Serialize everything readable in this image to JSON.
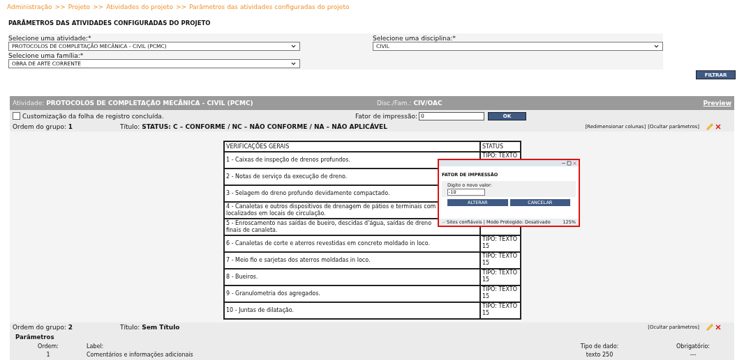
{
  "breadcrumb": {
    "separator": ">>",
    "items": [
      "Administração",
      "Projeto",
      "Atividades do projeto",
      "Parâmetros das atividades configuradas do projeto"
    ]
  },
  "page_title": "PARÂMETROS DAS ATIVIDADES CONFIGURADAS DO PROJETO",
  "filters": [
    {
      "label": "Selecione uma atividade:*",
      "value": "PROTOCOLOS DE COMPLETAÇÃO MECÂNICA - CIVIL (PCMC)"
    },
    {
      "label": "Selecione uma disciplina:*",
      "value": "CIVIL"
    },
    {
      "label": "Selecione uma família:*",
      "value": "OBRA DE ARTE CORRENTE"
    }
  ],
  "filter_button": "FILTRAR",
  "activity": {
    "label": "Atividade:",
    "value": "PROTOCOLOS DE COMPLETAÇÃO MECÂNICA - CIVIL (PCMC)",
    "disc_label": "Disc./Fam.:",
    "disc_value": "CIV/OAC",
    "preview": "Preview"
  },
  "customization": {
    "label": "Customização da folha de registro concluída.",
    "checked": false
  },
  "print_factor": {
    "label": "Fator de impressão:",
    "value": "0",
    "button": "OK"
  },
  "groups": [
    {
      "order_label": "Ordem do grupo:",
      "order": "1",
      "title_label": "Título:",
      "title": "STATUS: C – CONFORME / NC – NÃO CONFORME / NA – NÃO APLICÁVEL",
      "links": [
        "[Redimensionar colunas]",
        "[Ocultar parâmetros]"
      ]
    },
    {
      "order_label": "Ordem do grupo:",
      "order": "2",
      "title_label": "Título:",
      "title": "Sem Título",
      "links": [
        "[Ocultar parâmetros]"
      ]
    }
  ],
  "checklist": {
    "columns": [
      "VERIFICAÇÕES GERAIS",
      "STATUS"
    ],
    "rows": [
      {
        "lines": [
          "1 - Caixas de inspeção de drenos profundos."
        ],
        "status": "TIPO: TEXTO"
      },
      {
        "lines": [
          "2 - Notas de serviço da execução de dreno."
        ]
      },
      {
        "lines": [
          "3 - Selagem do dreno profundo devidamente compactado."
        ]
      },
      {
        "lines": [
          "4 - Canaletas e outros dispositivos de drenagem de pátios e terminais com",
          "localizados em locais de circulação."
        ]
      },
      {
        "lines": [
          "5 - Enroscamento nas saídas de bueiro, descidas d'água, saídas de dreno",
          "finais de canaleta."
        ]
      },
      {
        "lines": [
          "6 - Canaletas de corte e aterros revestidas em concreto moldado in loco."
        ],
        "status": "TIPO: TEXTO 15"
      },
      {
        "lines": [
          "7 - Meio fio e sarjetas dos aterros moldadas in loco."
        ],
        "status": "TIPO: TEXTO 15"
      },
      {
        "lines": [
          "8 - Bueiros."
        ],
        "status": "TIPO: TEXTO 15"
      },
      {
        "lines": [
          "9 - Granulometria dos agregados."
        ],
        "status": "TIPO: TEXTO 15"
      },
      {
        "lines": [
          "10 - Juntas de dilatação."
        ],
        "status": "TIPO: TEXTO 15"
      }
    ]
  },
  "popup": {
    "heading": "FATOR DE IMPRESSÃO",
    "field_label": "Digite o novo valor:",
    "field_value": "-10",
    "buttons": [
      "ALTERAR",
      "CANCELAR"
    ],
    "status_text": "Sites confiáveis | Modo Protegido: Desativado",
    "zoom": "125%"
  },
  "parameters": {
    "title": "Parâmetros",
    "columns": [
      "Ordem:",
      "Label:",
      "Tipo de dado:",
      "Obrigatório:"
    ],
    "rows": [
      [
        "1",
        "Comentários e informações adicionais",
        "texto 250",
        "---"
      ]
    ]
  }
}
